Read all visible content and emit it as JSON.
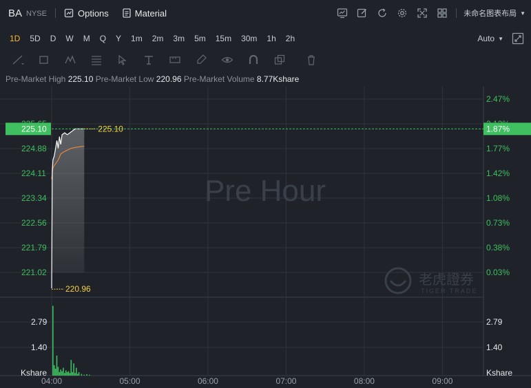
{
  "header": {
    "ticker": "BA",
    "exchange": "NYSE",
    "options_label": "Options",
    "material_label": "Material",
    "layout_name": "未命名图表布局"
  },
  "periods": [
    "1D",
    "5D",
    "D",
    "W",
    "M",
    "Q",
    "Y",
    "1m",
    "2m",
    "3m",
    "5m",
    "15m",
    "30m",
    "1h",
    "2h"
  ],
  "active_period": "1D",
  "scale_mode": "Auto",
  "info": {
    "high_label": "Pre-Market High",
    "high_value": "225.10",
    "low_label": "Pre-Market Low",
    "low_value": "220.96",
    "volume_label": "Pre-Market Volume",
    "volume_value": "8.77Kshare"
  },
  "watermark": {
    "text": "Pre Hour",
    "brand_cn": "老虎證券",
    "brand_en": "TIGER TRADE"
  },
  "colors": {
    "up": "#3fbf5f",
    "price_line": "#ffffff",
    "avg_line": "#f08a3a",
    "label_yellow": "#f5d040",
    "grid": "#2e343c"
  },
  "chart_data": {
    "type": "line",
    "price_axis": {
      "ticks": [
        225.65,
        224.11,
        223.34,
        222.56,
        221.79,
        221.02
      ],
      "tick_labels": [
        "225.65",
        "224.88",
        "224.11",
        "223.34",
        "222.56",
        "221.79",
        "221.02"
      ],
      "range": [
        220.75,
        226.12
      ],
      "current": "225.10"
    },
    "pct_axis": {
      "labels": [
        "2.47%",
        "2.12%",
        "1.77%",
        "1.42%",
        "1.08%",
        "0.73%",
        "0.38%",
        "0.03%"
      ],
      "current": "1.87%"
    },
    "x_axis": {
      "labels": [
        "04:00",
        "05:00",
        "06:00",
        "07:00",
        "08:00",
        "09:00"
      ],
      "range_minutes": [
        0,
        330
      ]
    },
    "high": {
      "value": 225.1,
      "label": "225.10"
    },
    "low": {
      "value": 220.96,
      "label": "220.96"
    },
    "price_series": {
      "x": [
        0,
        0.5,
        1,
        2,
        3,
        4,
        5,
        6,
        7,
        8,
        10,
        12,
        14,
        16,
        18,
        20,
        22,
        25
      ],
      "y": [
        220.98,
        224.0,
        224.3,
        224.4,
        224.6,
        224.8,
        224.6,
        224.9,
        224.7,
        224.95,
        225.0,
        224.95,
        225.0,
        225.05,
        225.1,
        225.1,
        225.1,
        225.1
      ]
    },
    "avg_series": {
      "x": [
        0,
        1,
        3,
        5,
        7,
        9,
        12,
        15,
        18,
        22,
        25
      ],
      "y": [
        223.8,
        224.1,
        224.2,
        224.3,
        224.45,
        224.5,
        224.55,
        224.6,
        224.62,
        224.64,
        224.65
      ]
    },
    "volume": {
      "unit": "Kshare",
      "tick_labels": [
        "2.79",
        "1.40"
      ],
      "ticks": [
        2.79,
        1.4
      ],
      "max": 4.1,
      "x": [
        0,
        1,
        2,
        3,
        4,
        5,
        6,
        7,
        8,
        9,
        10,
        11,
        12,
        13,
        14,
        15,
        16,
        17,
        18,
        19,
        20,
        22,
        24,
        26,
        28
      ],
      "values": [
        4.0,
        0.6,
        0.4,
        1.15,
        0.5,
        0.2,
        0.35,
        0.25,
        0.45,
        0.15,
        0.3,
        0.2,
        0.25,
        0.15,
        0.9,
        0.2,
        0.7,
        0.15,
        0.45,
        0.1,
        0.2,
        0.1,
        0.05,
        0.08,
        0.05
      ]
    }
  }
}
